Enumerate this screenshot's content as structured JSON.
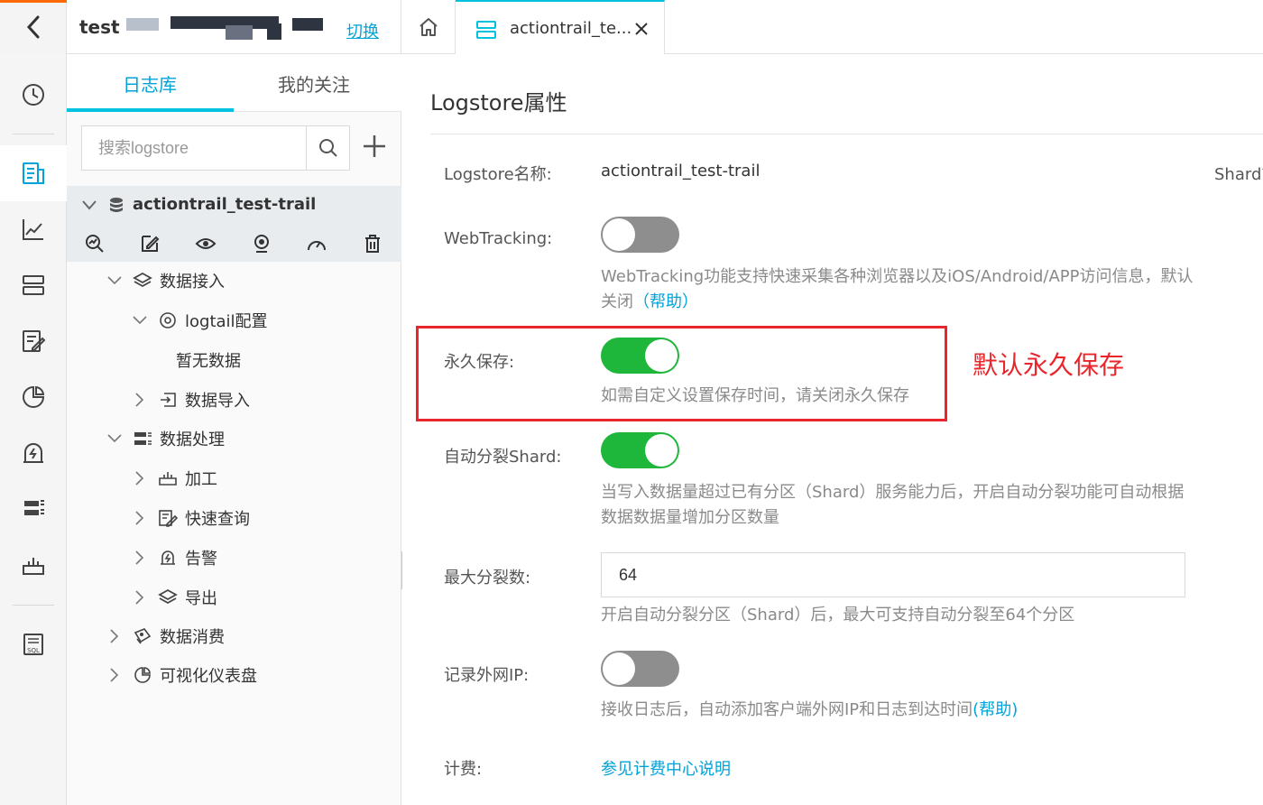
{
  "header": {
    "project_name": "test",
    "switch_label": "切换",
    "tab_label": "actiontrail_te..."
  },
  "sidebar_tabs": {
    "logstores": "日志库",
    "favorites": "我的关注"
  },
  "search": {
    "placeholder": "搜索logstore"
  },
  "logstore": {
    "name": "actiontrail_test-trail"
  },
  "tree": {
    "data_ingest": "数据接入",
    "logtail_config": "logtail配置",
    "no_data": "暂无数据",
    "data_import": "数据导入",
    "data_processing": "数据处理",
    "transform": "加工",
    "quick_query": "快速查询",
    "alert": "告警",
    "export": "导出",
    "data_consume": "数据消费",
    "dashboard": "可视化仪表盘"
  },
  "main": {
    "title": "Logstore属性",
    "name_label": "Logstore名称:",
    "name_value": "actiontrail_test-trail",
    "shard_cut_label": "Shard管",
    "webtracking_label": "WebTracking:",
    "webtracking_on": false,
    "webtracking_help": "WebTracking功能支持快速采集各种浏览器以及iOS/Android/APP访问信息，默认关闭",
    "help_link": "（帮助）",
    "permanent_label": "永久保存:",
    "permanent_on": true,
    "permanent_help": "如需自定义设置保存时间，请关闭永久保存",
    "autosplit_label": "自动分裂Shard:",
    "autosplit_on": true,
    "autosplit_help": "当写入数据量超过已有分区（Shard）服务能力后，开启自动分裂功能可自动根据数据数据量增加分区数量",
    "max_split_label": "最大分裂数:",
    "max_split_value": "64",
    "max_split_help": "开启自动分裂分区（Shard）后，最大可支持自动分裂至64个分区",
    "record_ip_label": "记录外网IP:",
    "record_ip_on": false,
    "record_ip_help": "接收日志后，自动添加客户端外网IP和日志到达时间",
    "record_ip_link": "(帮助)",
    "billing_label": "计费:",
    "billing_link": "参见计费中心说明"
  },
  "annotation": {
    "text": "默认永久保存",
    "color": "#e8262b"
  },
  "colors": {
    "accent": "#00c1de",
    "link": "#00a3d9",
    "toggle_on": "#1fb73b",
    "toggle_off": "#8e8e8e",
    "brand_orange": "#ff6a00"
  },
  "icons": [
    "chevron-left-icon",
    "home-icon",
    "logstore-tab-icon",
    "close-icon",
    "clock-icon",
    "log-icon",
    "chart-icon",
    "storage-icon",
    "query-icon",
    "dashboard-pie-icon",
    "alert-icon",
    "processing-icon",
    "transform-icon",
    "sql-icon",
    "search-icon",
    "plus-icon",
    "database-icon"
  ]
}
